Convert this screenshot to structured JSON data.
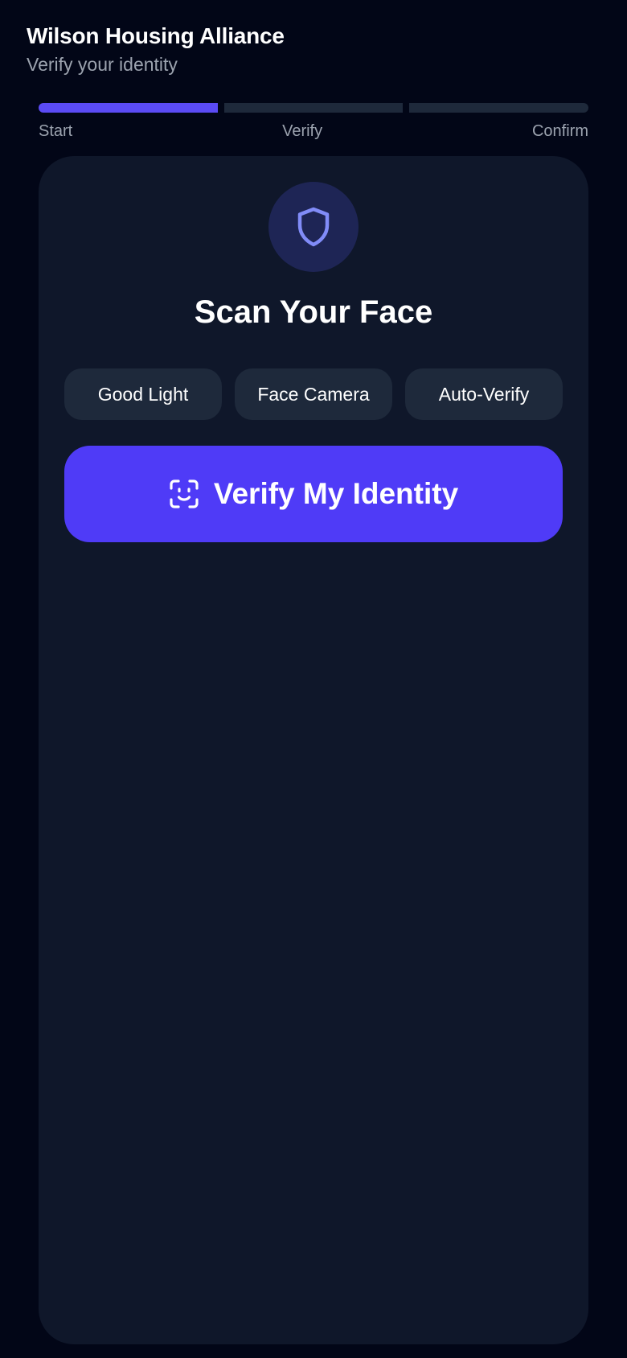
{
  "header": {
    "title": "Wilson Housing Alliance",
    "subtitle": "Verify your identity"
  },
  "progress": {
    "steps": [
      "Start",
      "Verify",
      "Confirm"
    ],
    "current_step": 1
  },
  "card": {
    "badge_icon": "shield-icon",
    "title": "Scan Your Face",
    "chips": [
      "Good Light",
      "Face Camera",
      "Auto-Verify"
    ],
    "button": {
      "icon": "face-scan-icon",
      "label": "Verify My Identity"
    }
  },
  "colors": {
    "background": "#020617",
    "card": "#0f172a",
    "accent": "#4f3bf7",
    "progress_active": "#5b4bf5",
    "progress_inactive": "#1e293b",
    "chip": "#1e293b",
    "badge": "#1e2555",
    "shield": "#818cf8",
    "muted_text": "#9ca3af"
  }
}
